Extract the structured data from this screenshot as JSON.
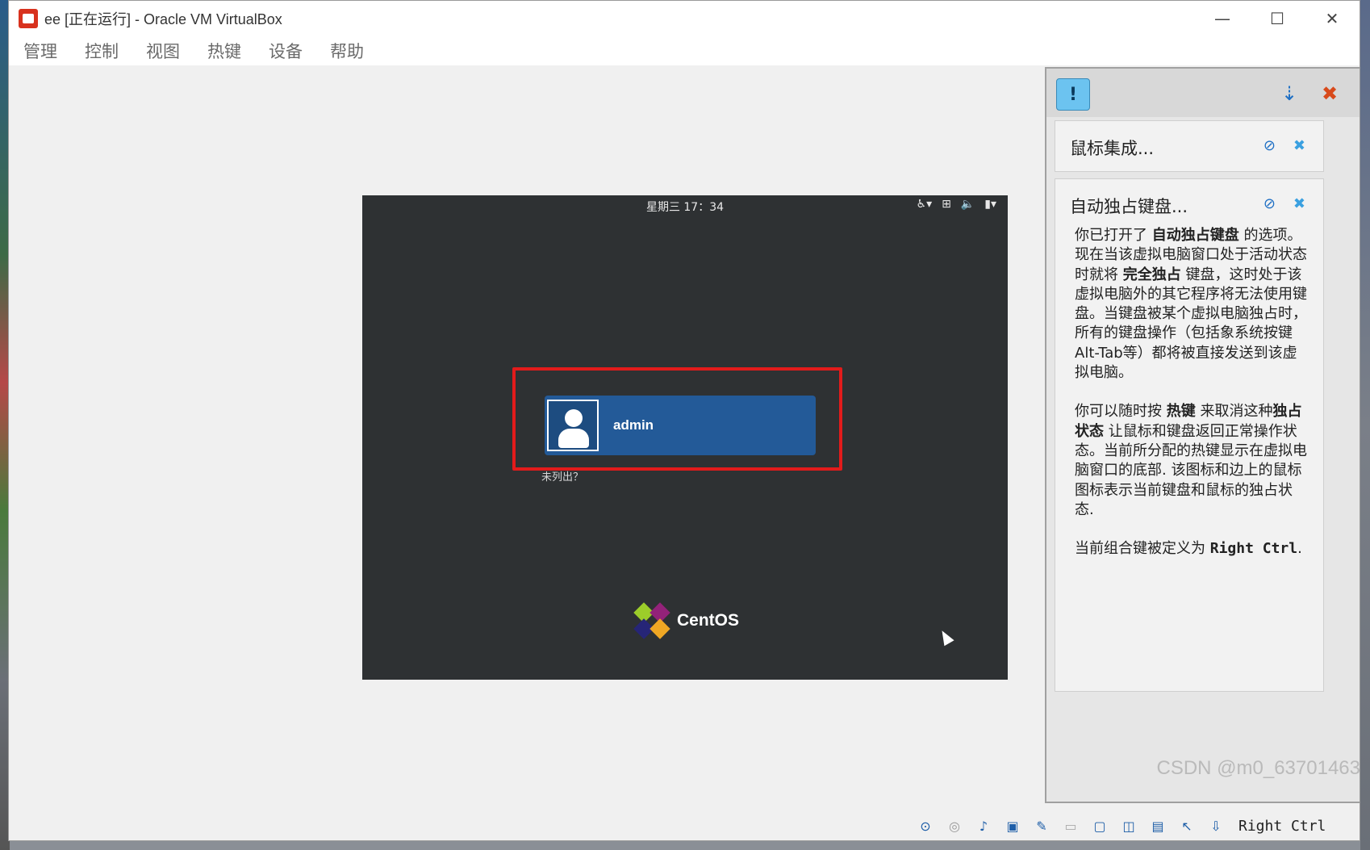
{
  "window": {
    "title": "ee [正在运行] - Oracle VM VirtualBox",
    "minimize": "—",
    "maximize": "☐",
    "close": "✕"
  },
  "menu": [
    "管理",
    "控制",
    "视图",
    "热键",
    "设备",
    "帮助"
  ],
  "vm": {
    "clock": "星期三 17：34",
    "username": "admin",
    "not_listed": "未列出？",
    "logo_text": "CentOS"
  },
  "notices": {
    "mouse_title": "鼠标集成...",
    "keyboard_title": "自动独占键盘...",
    "p1_a": "你已打开了 ",
    "p1_b": "自动独占键盘",
    "p1_c": " 的选项。现在当该虚拟电脑窗口处于活动状态时就将 ",
    "p1_d": "完全独占",
    "p1_e": " 键盘，这时处于该虚拟电脑外的其它程序将无法使用键盘。当键盘被某个虚拟电脑独占时，所有的键盘操作（包括象系统按键Alt-Tab等）都将被直接发送到该虚拟电脑。",
    "p2_a": "你可以随时按 ",
    "p2_b": "热键",
    "p2_c": " 来取消这种",
    "p2_d": "独占状态",
    "p2_e": " 让鼠标和键盘返回正常操作状态。当前所分配的热键显示在虚拟电脑窗口的底部. 该图标和边上的鼠标图标表示当前键盘和鼠标的独占状态.",
    "p3_a": "当前组合键被定义为 ",
    "p3_b": "Right Ctrl",
    "p3_c": "."
  },
  "status": {
    "host_key": "Right Ctrl",
    "watermark": "CSDN @m0_63701463"
  },
  "colors": {
    "vm_bg": "#2e3133",
    "user_card": "#235a98",
    "highlight": "#e21b1b",
    "notice_button": "#6cc3f0"
  }
}
